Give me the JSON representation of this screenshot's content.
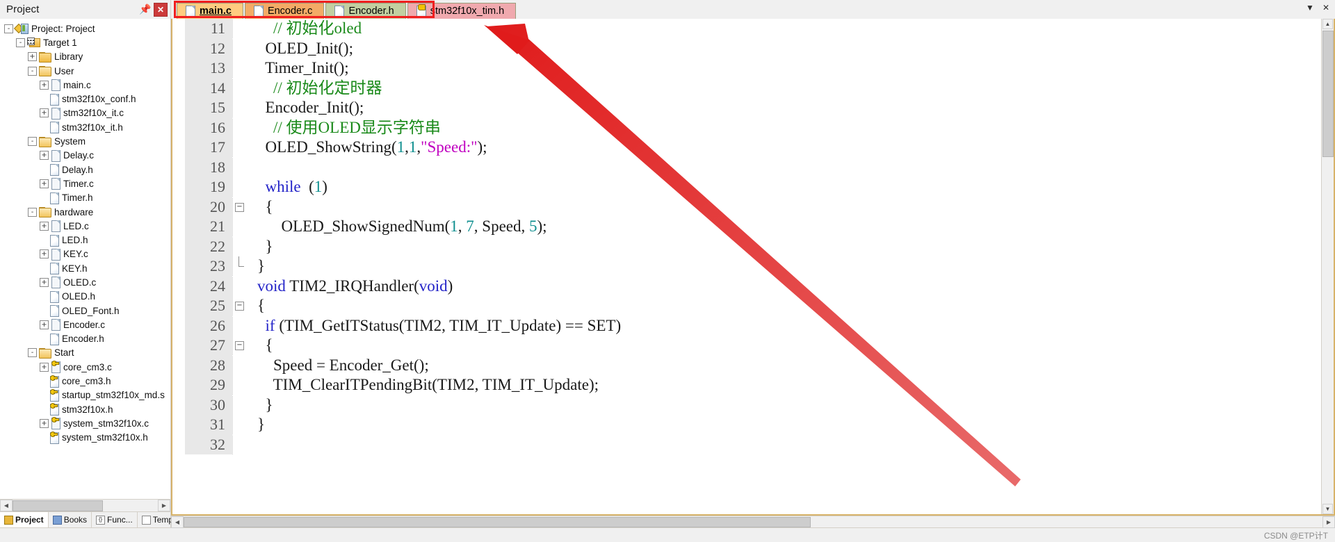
{
  "window": {
    "project_pane_title": "Project",
    "pin_icon": "pin-icon",
    "close_icon": "close-icon"
  },
  "sidebar": {
    "tree": [
      {
        "label": "Project: Project",
        "depth": 0,
        "expander": "-",
        "icon": "project-icon"
      },
      {
        "label": "Target 1",
        "depth": 1,
        "expander": "-",
        "icon": "target-icon"
      },
      {
        "label": "Library",
        "depth": 2,
        "expander": "+",
        "icon": "folder-icon"
      },
      {
        "label": "User",
        "depth": 2,
        "expander": "-",
        "icon": "folder-open-icon"
      },
      {
        "label": "main.c",
        "depth": 3,
        "expander": "+",
        "icon": "source-file-icon"
      },
      {
        "label": "stm32f10x_conf.h",
        "depth": 3,
        "expander": "",
        "icon": "header-file-icon"
      },
      {
        "label": "stm32f10x_it.c",
        "depth": 3,
        "expander": "+",
        "icon": "source-file-icon"
      },
      {
        "label": "stm32f10x_it.h",
        "depth": 3,
        "expander": "",
        "icon": "header-file-icon"
      },
      {
        "label": "System",
        "depth": 2,
        "expander": "-",
        "icon": "folder-open-icon"
      },
      {
        "label": "Delay.c",
        "depth": 3,
        "expander": "+",
        "icon": "source-file-icon"
      },
      {
        "label": "Delay.h",
        "depth": 3,
        "expander": "",
        "icon": "header-file-icon"
      },
      {
        "label": "Timer.c",
        "depth": 3,
        "expander": "+",
        "icon": "source-file-icon"
      },
      {
        "label": "Timer.h",
        "depth": 3,
        "expander": "",
        "icon": "header-file-icon"
      },
      {
        "label": "hardware",
        "depth": 2,
        "expander": "-",
        "icon": "folder-open-icon"
      },
      {
        "label": "LED.c",
        "depth": 3,
        "expander": "+",
        "icon": "source-file-icon"
      },
      {
        "label": "LED.h",
        "depth": 3,
        "expander": "",
        "icon": "header-file-icon"
      },
      {
        "label": "KEY.c",
        "depth": 3,
        "expander": "+",
        "icon": "source-file-icon"
      },
      {
        "label": "KEY.h",
        "depth": 3,
        "expander": "",
        "icon": "header-file-icon"
      },
      {
        "label": "OLED.c",
        "depth": 3,
        "expander": "+",
        "icon": "source-file-icon"
      },
      {
        "label": "OLED.h",
        "depth": 3,
        "expander": "",
        "icon": "header-file-icon"
      },
      {
        "label": "OLED_Font.h",
        "depth": 3,
        "expander": "",
        "icon": "header-file-icon"
      },
      {
        "label": "Encoder.c",
        "depth": 3,
        "expander": "+",
        "icon": "source-file-icon"
      },
      {
        "label": "Encoder.h",
        "depth": 3,
        "expander": "",
        "icon": "header-file-icon"
      },
      {
        "label": "Start",
        "depth": 2,
        "expander": "-",
        "icon": "folder-open-icon"
      },
      {
        "label": "core_cm3.c",
        "depth": 3,
        "expander": "+",
        "icon": "readonly-source-icon"
      },
      {
        "label": "core_cm3.h",
        "depth": 3,
        "expander": "",
        "icon": "readonly-header-icon"
      },
      {
        "label": "startup_stm32f10x_md.s",
        "depth": 3,
        "expander": "",
        "icon": "readonly-header-icon"
      },
      {
        "label": "stm32f10x.h",
        "depth": 3,
        "expander": "",
        "icon": "readonly-header-icon"
      },
      {
        "label": "system_stm32f10x.c",
        "depth": 3,
        "expander": "+",
        "icon": "readonly-source-icon"
      },
      {
        "label": "system_stm32f10x.h",
        "depth": 3,
        "expander": "",
        "icon": "readonly-header-icon"
      }
    ],
    "bottom_tabs": [
      {
        "label": "Project",
        "icon": "project-icon",
        "active": true
      },
      {
        "label": "Books",
        "icon": "books-icon",
        "active": false
      },
      {
        "label": "Func...",
        "icon": "functions-icon",
        "active": false
      },
      {
        "label": "Temp...",
        "icon": "templates-icon",
        "active": false
      }
    ]
  },
  "editor": {
    "tabs": [
      {
        "label": "main.c",
        "active": true,
        "style": "active",
        "icon": "source-file-icon"
      },
      {
        "label": "Encoder.c",
        "active": false,
        "style": "orange",
        "icon": "source-file-icon"
      },
      {
        "label": "Encoder.h",
        "active": false,
        "style": "green",
        "icon": "header-file-icon"
      },
      {
        "label": "stm32f10x_tim.h",
        "active": false,
        "style": "pink",
        "icon": "readonly-header-icon"
      }
    ],
    "tab_right_icons": [
      "chevron-down-icon",
      "close-icon"
    ],
    "first_line_number": 11,
    "lines": [
      {
        "num": "11",
        "fold": "",
        "tokens": [
          {
            "t": "    ",
            "c": "plain"
          },
          {
            "t": "// 初始化oled",
            "c": "comment"
          }
        ]
      },
      {
        "num": "12",
        "fold": "",
        "tokens": [
          {
            "t": "  OLED_Init();",
            "c": "plain"
          }
        ]
      },
      {
        "num": "13",
        "fold": "",
        "tokens": [
          {
            "t": "  Timer_Init();",
            "c": "plain"
          }
        ]
      },
      {
        "num": "14",
        "fold": "",
        "tokens": [
          {
            "t": "    ",
            "c": "plain"
          },
          {
            "t": "// 初始化定时器",
            "c": "comment"
          }
        ]
      },
      {
        "num": "15",
        "fold": "",
        "tokens": [
          {
            "t": "  Encoder_Init();",
            "c": "plain"
          }
        ]
      },
      {
        "num": "16",
        "fold": "",
        "tokens": [
          {
            "t": "    ",
            "c": "plain"
          },
          {
            "t": "// 使用OLED显示字符串",
            "c": "comment"
          }
        ]
      },
      {
        "num": "17",
        "fold": "",
        "tokens": [
          {
            "t": "  OLED_ShowString(",
            "c": "plain"
          },
          {
            "t": "1",
            "c": "num"
          },
          {
            "t": ",",
            "c": "plain"
          },
          {
            "t": "1",
            "c": "num"
          },
          {
            "t": ",",
            "c": "plain"
          },
          {
            "t": "\"Speed:\"",
            "c": "str"
          },
          {
            "t": ");",
            "c": "plain"
          }
        ]
      },
      {
        "num": "18",
        "fold": "",
        "tokens": [
          {
            "t": "",
            "c": "plain"
          }
        ]
      },
      {
        "num": "19",
        "fold": "",
        "tokens": [
          {
            "t": "  ",
            "c": "plain"
          },
          {
            "t": "while",
            "c": "keyword"
          },
          {
            "t": "  (",
            "c": "plain"
          },
          {
            "t": "1",
            "c": "num"
          },
          {
            "t": ")",
            "c": "plain"
          }
        ]
      },
      {
        "num": "20",
        "fold": "-",
        "tokens": [
          {
            "t": "  {",
            "c": "plain"
          }
        ]
      },
      {
        "num": "21",
        "fold": "",
        "tokens": [
          {
            "t": "      OLED_ShowSignedNum(",
            "c": "plain"
          },
          {
            "t": "1",
            "c": "num"
          },
          {
            "t": ", ",
            "c": "plain"
          },
          {
            "t": "7",
            "c": "num"
          },
          {
            "t": ", Speed, ",
            "c": "plain"
          },
          {
            "t": "5",
            "c": "num"
          },
          {
            "t": ");",
            "c": "plain"
          }
        ]
      },
      {
        "num": "22",
        "fold": "",
        "tokens": [
          {
            "t": "  }",
            "c": "plain"
          }
        ]
      },
      {
        "num": "23",
        "fold": "end",
        "tokens": [
          {
            "t": "}",
            "c": "plain"
          }
        ]
      },
      {
        "num": "24",
        "fold": "",
        "tokens": [
          {
            "t": "void",
            "c": "keyword"
          },
          {
            "t": " TIM2_IRQHandler(",
            "c": "plain"
          },
          {
            "t": "void",
            "c": "keyword"
          },
          {
            "t": ")",
            "c": "plain"
          }
        ]
      },
      {
        "num": "25",
        "fold": "-",
        "tokens": [
          {
            "t": "{",
            "c": "plain"
          }
        ]
      },
      {
        "num": "26",
        "fold": "",
        "tokens": [
          {
            "t": "  ",
            "c": "plain"
          },
          {
            "t": "if",
            "c": "keyword"
          },
          {
            "t": " (TIM_GetITStatus(TIM2, TIM_IT_Update) == SET)",
            "c": "plain"
          }
        ]
      },
      {
        "num": "27",
        "fold": "-",
        "tokens": [
          {
            "t": "  {",
            "c": "plain"
          }
        ]
      },
      {
        "num": "28",
        "fold": "",
        "tokens": [
          {
            "t": "    Speed = Encoder_Get();",
            "c": "plain"
          }
        ]
      },
      {
        "num": "29",
        "fold": "",
        "tokens": [
          {
            "t": "    TIM_ClearITPendingBit(TIM2, TIM_IT_Update);",
            "c": "plain"
          }
        ]
      },
      {
        "num": "30",
        "fold": "",
        "tokens": [
          {
            "t": "  }",
            "c": "plain"
          }
        ]
      },
      {
        "num": "31",
        "fold": "",
        "tokens": [
          {
            "t": "}",
            "c": "plain"
          }
        ]
      },
      {
        "num": "32",
        "fold": "",
        "tokens": [
          {
            "t": "",
            "c": "plain"
          }
        ]
      }
    ]
  },
  "annotation": {
    "arrow_color": "#e32020",
    "highlight_color": "#f01e1e"
  },
  "statusbar": {
    "watermark": "CSDN @ETP计T"
  }
}
